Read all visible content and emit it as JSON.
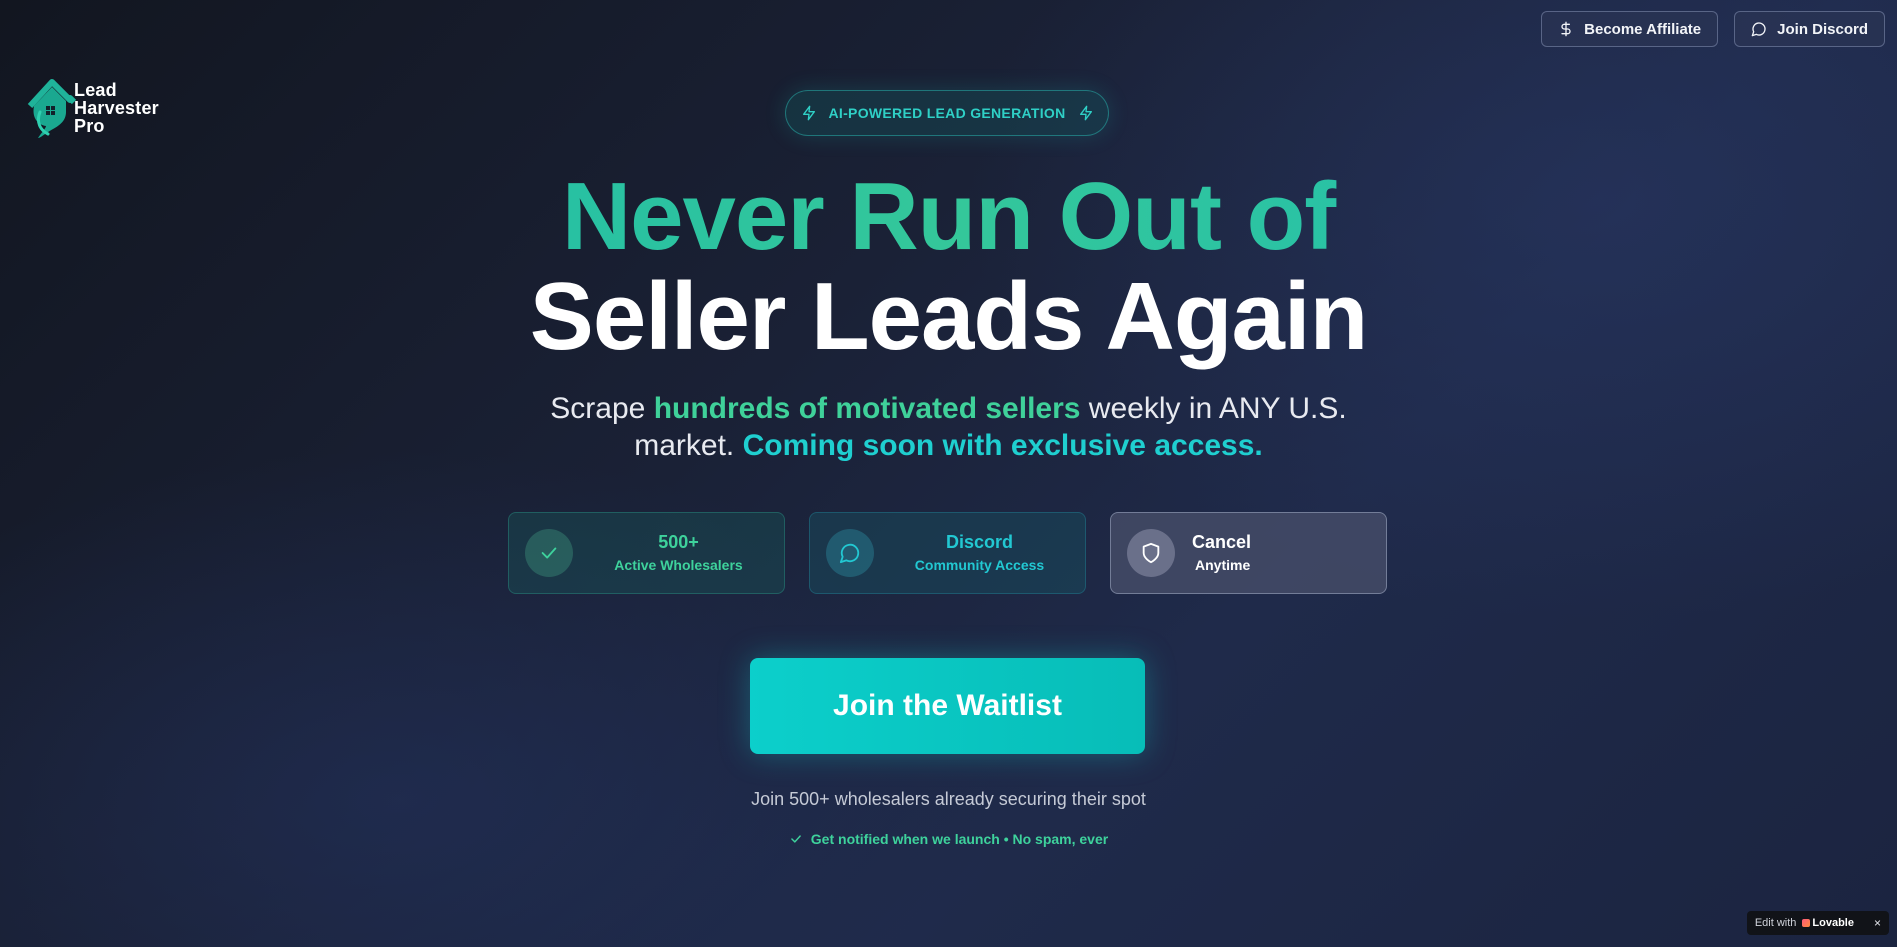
{
  "header": {
    "affiliate_label": "Become Affiliate",
    "discord_label": "Join Discord"
  },
  "logo": {
    "line1": "Lead",
    "line2": "Harvester",
    "line3": "Pro"
  },
  "badge": {
    "label": "AI-POWERED LEAD GENERATION"
  },
  "hero": {
    "headline_line1": "Never Run Out of",
    "headline_line2": "Seller Leads Again",
    "sub_a": "Scrape ",
    "sub_b": "hundreds of motivated sellers",
    "sub_c": " weekly in ANY U.S. market. ",
    "sub_d": "Coming soon with exclusive access."
  },
  "features": [
    {
      "title": "500+",
      "subtitle": "Active Wholesalers",
      "icon": "check-icon"
    },
    {
      "title": "Discord",
      "subtitle": "Community Access",
      "icon": "chat-bubble-icon"
    },
    {
      "title": "Cancel",
      "subtitle": "Anytime",
      "icon": "shield-icon"
    }
  ],
  "cta": {
    "label": "Join the Waitlist"
  },
  "social_proof": "Join 500+ wholesalers already securing their spot",
  "notify": "Get notified when we launch • No spam, ever",
  "lovable": {
    "prefix": "Edit with",
    "brand": "Lovable",
    "close": "×"
  },
  "colors": {
    "accent_teal": "#1fcfd0",
    "accent_green": "#3ed29c",
    "background": "#1a2136"
  }
}
